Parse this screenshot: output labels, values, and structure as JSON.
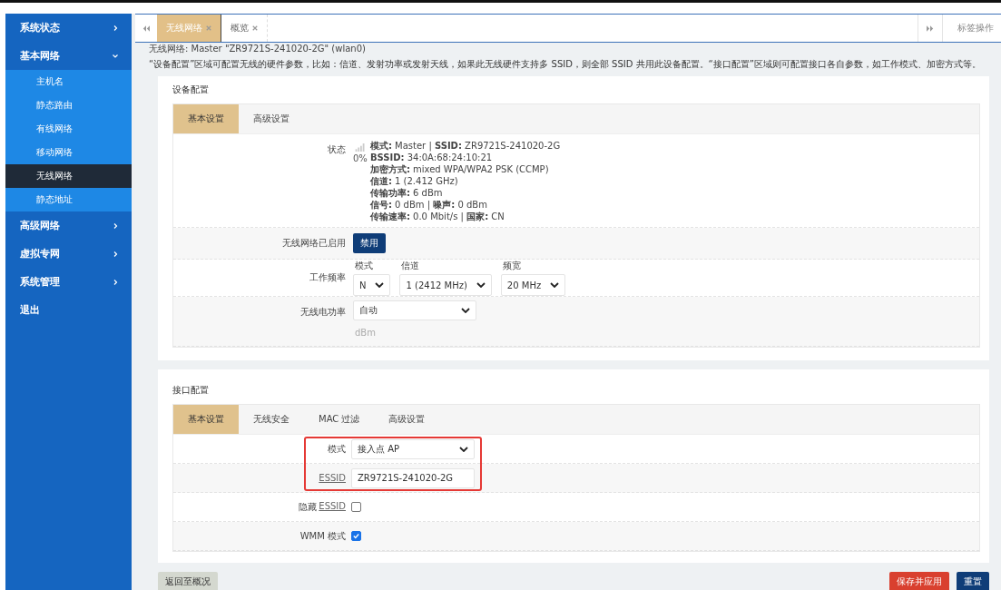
{
  "sidebar": {
    "items": [
      {
        "label": "系统状态",
        "expanded": false
      },
      {
        "label": "基本网络",
        "expanded": true,
        "children": [
          {
            "label": "主机名",
            "selected": false
          },
          {
            "label": "静态路由",
            "selected": false
          },
          {
            "label": "有线网络",
            "selected": false
          },
          {
            "label": "移动网络",
            "selected": false
          },
          {
            "label": "无线网络",
            "selected": true
          },
          {
            "label": "静态地址",
            "selected": false
          }
        ]
      },
      {
        "label": "高级网络",
        "expanded": false
      },
      {
        "label": "虚拟专网",
        "expanded": false
      },
      {
        "label": "系统管理",
        "expanded": false
      },
      {
        "label": "退出"
      }
    ]
  },
  "tabs": [
    {
      "label": "无线网络",
      "selected": true
    },
    {
      "label": "概览",
      "selected": false
    }
  ],
  "tab_actions": "标签操作",
  "heading": "无线网络: Master \"ZR9721S-241020-2G\" (wlan0)",
  "description": "“设备配置”区域可配置无线的硬件参数，比如：信道、发射功率或发射天线，如果此无线硬件支持多 SSID，则全部 SSID 共用此设备配置。“接口配置”区域则可配置接口各自参数，如工作模式、加密方式等。",
  "device_config": {
    "title": "设备配置",
    "tabs": [
      {
        "label": "基本设置",
        "selected": true
      },
      {
        "label": "高级设置",
        "selected": false
      }
    ],
    "status": {
      "label": "状态",
      "signal": "0%",
      "lines": [
        "**模式:** Master | **SSID:** ZR9721S-241020-2G",
        "**BSSID:** 34:0A:68:24:10:21",
        "**加密方式:** mixed WPA/WPA2 PSK (CCMP)",
        "**信道:** 1 (2.412 GHz)",
        "**传输功率:** 6 dBm",
        "**信号:** 0 dBm | **噪声:** 0 dBm",
        "**传输速率:** 0.0 Mbit/s | **国家:** CN"
      ]
    },
    "enabled": {
      "label": "无线网络已启用",
      "button": "禁用"
    },
    "frequency": {
      "label": "工作频率",
      "selects": [
        {
          "caption": "模式",
          "value": "N"
        },
        {
          "caption": "信道",
          "value": "1 (2412 MHz)"
        },
        {
          "caption": "频宽",
          "value": "20 MHz"
        }
      ]
    },
    "power": {
      "label": "无线电功率",
      "value": "自动",
      "unit": "dBm"
    }
  },
  "interface_config": {
    "title": "接口配置",
    "tabs": [
      {
        "label": "基本设置",
        "selected": true
      },
      {
        "label": "无线安全",
        "selected": false
      },
      {
        "label": "MAC 过滤",
        "selected": false
      },
      {
        "label": "高级设置",
        "selected": false
      }
    ],
    "rows": [
      {
        "kind": "select",
        "label": "模式",
        "value": "接入点 AP",
        "highlighted": true
      },
      {
        "kind": "input",
        "link": "ESSID",
        "value": "ZR9721S-241020-2G",
        "highlighted": true
      },
      {
        "kind": "checkbox",
        "label": "隐藏",
        "link": "ESSID",
        "checked": false
      },
      {
        "kind": "checkbox",
        "label": "WMM 模式",
        "checked": true
      }
    ]
  },
  "buttons": [
    {
      "kind": "secondary",
      "label": "返回至概况"
    },
    {
      "kind": "danger",
      "label": "保存并应用"
    },
    {
      "kind": "primary",
      "label": "重置"
    }
  ]
}
